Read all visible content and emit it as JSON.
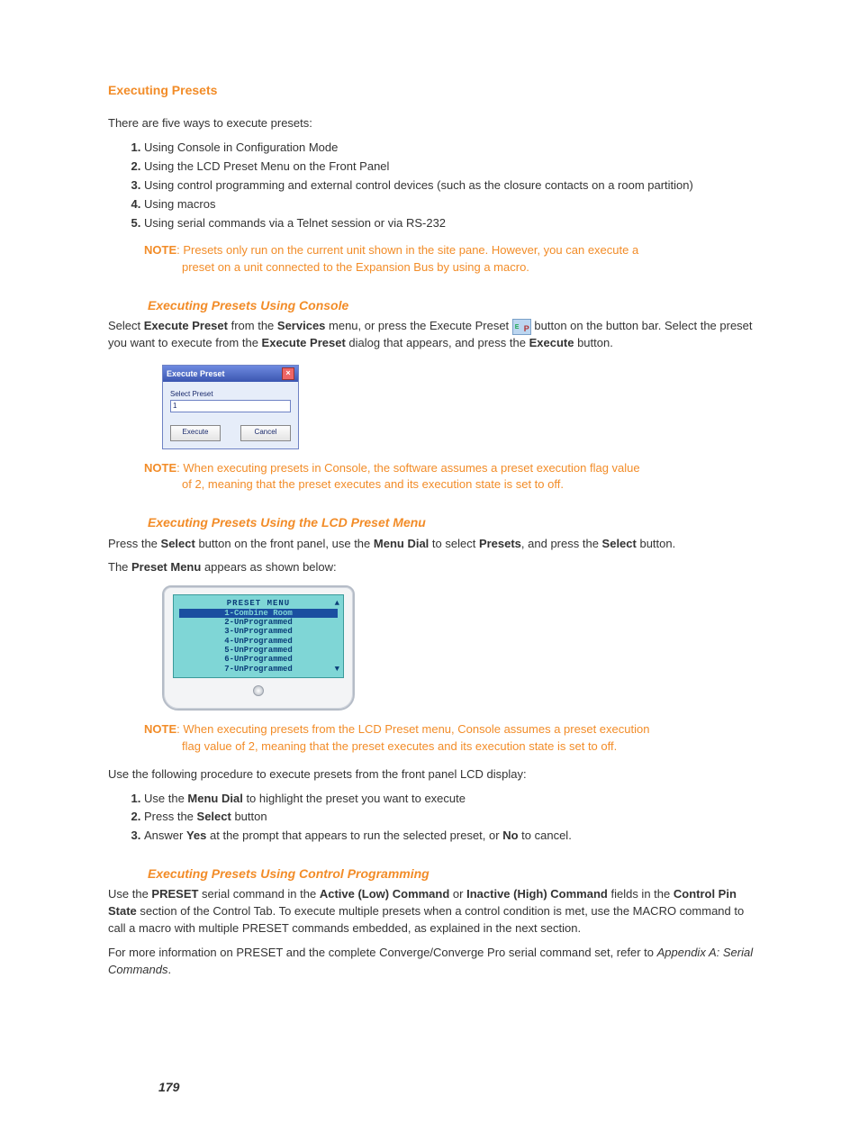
{
  "heading": "Executing Presets",
  "intro": "There are five ways to execute presets:",
  "ways": [
    "Using Console in Configuration Mode",
    "Using the LCD Preset Menu on the Front Panel",
    "Using control programming and external control devices (such as the closure contacts on a room partition)",
    "Using macros",
    "Using serial commands via a Telnet session or via RS-232"
  ],
  "note1_label": "NOTE",
  "note1_a": ": Presets only run on the current unit shown in the site pane. However, you can execute a",
  "note1_b": "preset on a unit connected to the Expansion Bus by using a macro.",
  "sub1_title": "Executing Presets Using Console",
  "sub1_p_a": "Select ",
  "sub1_p_b": "Execute Preset",
  "sub1_p_c": " from the ",
  "sub1_p_d": "Services",
  "sub1_p_e": " menu, or press the Execute Preset ",
  "sub1_p_f": " button on the button bar. Select the preset you want to execute from the ",
  "sub1_p_g": "Execute Preset",
  "sub1_p_h": " dialog that appears, and press the ",
  "sub1_p_i": "Execute",
  "sub1_p_j": " button.",
  "dialog": {
    "title": "Execute Preset",
    "label": "Select Preset",
    "value": "1",
    "execute": "Execute",
    "cancel": "Cancel"
  },
  "note2_label": "NOTE",
  "note2_a": ": When executing presets in Console, the software assumes a preset execution flag value",
  "note2_b": "of 2, meaning that the preset executes and its execution state is set to off.",
  "sub2_title": "Executing Presets Using the LCD Preset Menu",
  "sub2_p_a": "Press the ",
  "sub2_p_b": "Select",
  "sub2_p_c": " button on the front panel, use the ",
  "sub2_p_d": "Menu Dial",
  "sub2_p_e": " to select ",
  "sub2_p_f": "Presets",
  "sub2_p_g": ", and press the ",
  "sub2_p_h": "Select",
  "sub2_p_i": " button.",
  "sub2_p2_a": "The ",
  "sub2_p2_b": "Preset Menu",
  "sub2_p2_c": " appears as shown below:",
  "lcd": {
    "title": "PRESET MENU",
    "items": [
      "1-Combine Room",
      "2-UnProgrammed",
      "3-UnProgrammed",
      "4-UnProgrammed",
      "5-UnProgrammed",
      "6-UnProgrammed",
      "7-UnProgrammed"
    ]
  },
  "note3_label": "NOTE",
  "note3_a": ": When executing presets from the LCD Preset menu, Console assumes a preset execution",
  "note3_b": "flag value of 2, meaning that the preset executes and its execution state is set to off.",
  "proc_intro": "Use the following procedure to execute presets from the front panel LCD display:",
  "proc_1a": "Use the ",
  "proc_1b": "Menu Dial",
  "proc_1c": " to highlight the preset you want to execute",
  "proc_2a": "Press the ",
  "proc_2b": "Select",
  "proc_2c": " button",
  "proc_3a": "Answer ",
  "proc_3b": "Yes",
  "proc_3c": " at the prompt that appears to run the selected preset, or ",
  "proc_3d": "No",
  "proc_3e": " to cancel.",
  "sub3_title": "Executing Presets Using Control Programming",
  "sub3_p1_a": "Use the ",
  "sub3_p1_b": "PRESET",
  "sub3_p1_c": " serial command in the ",
  "sub3_p1_d": "Active (Low) Command",
  "sub3_p1_e": " or ",
  "sub3_p1_f": "Inactive (High) Command",
  "sub3_p1_g": " fields in the ",
  "sub3_p1_h": "Control Pin State",
  "sub3_p1_i": " section of the Control Tab. To execute multiple presets when a control condition is met, use the MACRO command to call a macro with multiple PRESET commands embedded, as explained in the next section.",
  "sub3_p2_a": "For more information on PRESET and the complete Converge/Converge Pro serial command set, refer to ",
  "sub3_p2_b": "Appendix A: Serial Commands",
  "sub3_p2_c": ".",
  "page_number": "179"
}
